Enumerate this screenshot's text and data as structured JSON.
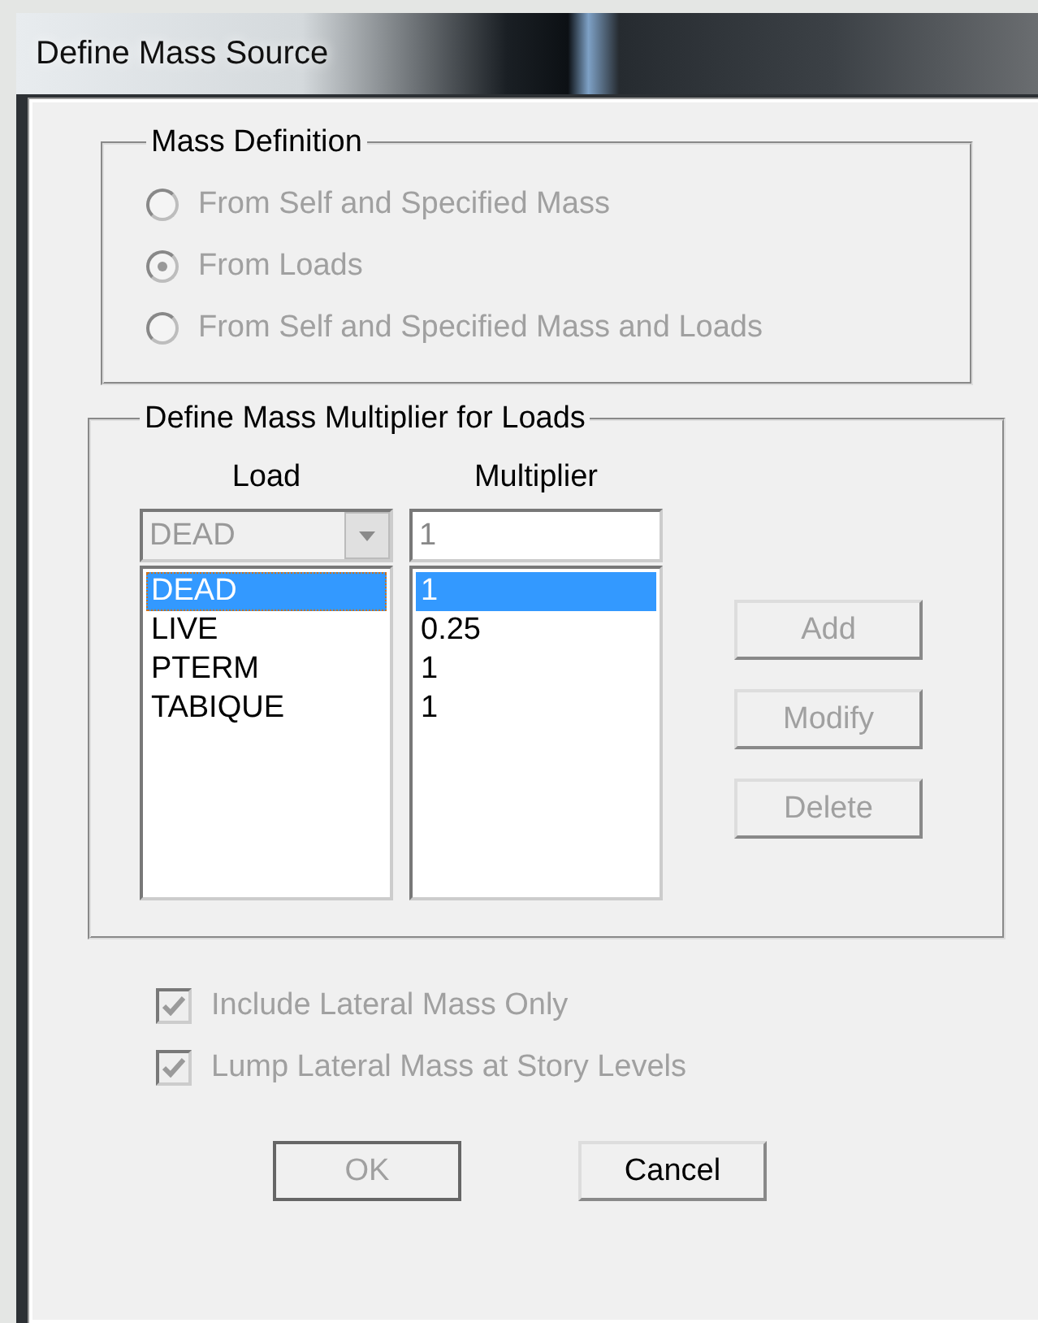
{
  "window": {
    "title": "Define Mass Source"
  },
  "mass_definition": {
    "legend": "Mass Definition",
    "options": [
      {
        "label": "From Self and Specified Mass",
        "selected": false,
        "disabled": true
      },
      {
        "label": "From Loads",
        "selected": true,
        "disabled": true
      },
      {
        "label": "From Self and Specified Mass and Loads",
        "selected": false,
        "disabled": true
      }
    ]
  },
  "multiplier_group": {
    "legend": "Define Mass Multiplier for Loads",
    "columns": [
      "Load",
      "Multiplier"
    ],
    "load_combo": {
      "value": "DEAD",
      "disabled": true
    },
    "multiplier_field": {
      "value": "1"
    },
    "rows": [
      {
        "load": "DEAD",
        "multiplier": "1",
        "selected": true
      },
      {
        "load": "LIVE",
        "multiplier": "0.25",
        "selected": false
      },
      {
        "load": "PTERM",
        "multiplier": "1",
        "selected": false
      },
      {
        "load": "TABIQUE",
        "multiplier": "1",
        "selected": false
      }
    ],
    "buttons": [
      {
        "label": "Add",
        "disabled": true
      },
      {
        "label": "Modify",
        "disabled": true
      },
      {
        "label": "Delete",
        "disabled": true
      }
    ]
  },
  "checkboxes": [
    {
      "label": "Include Lateral Mass Only",
      "checked": true,
      "disabled": true
    },
    {
      "label": "Lump Lateral Mass at Story Levels",
      "checked": true,
      "disabled": true
    }
  ],
  "buttons": [
    {
      "label": "OK",
      "disabled": true
    },
    {
      "label": "Cancel",
      "disabled": false
    }
  ]
}
